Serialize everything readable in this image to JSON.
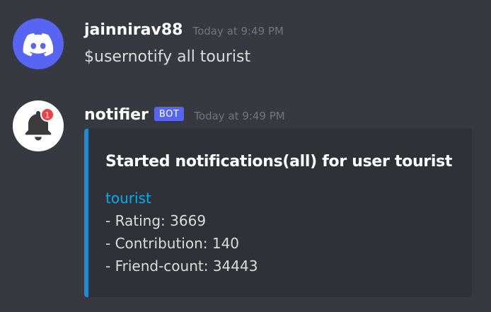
{
  "messages": [
    {
      "author": "jainnirav88",
      "timestamp": "Today at 9:49 PM",
      "avatar_icon": "discord-logo-icon",
      "avatar_color": "#5865f2",
      "content": "$usernotify all tourist"
    },
    {
      "author": "notifier",
      "bot_tag": "BOT",
      "timestamp": "Today at 9:49 PM",
      "avatar_icon": "notification-bell-icon",
      "avatar_badge": "1",
      "embed": {
        "accent_color": "#1f8ad6",
        "title": "Started notifications(all) for user tourist",
        "link_text": "tourist",
        "lines": [
          "- Rating: 3669",
          "- Contribution: 140",
          "- Friend-count: 34443"
        ]
      }
    }
  ],
  "colors": {
    "background": "#36393f",
    "embed_background": "#2f3136",
    "link": "#00aff4",
    "bot_tag": "#5865f2"
  }
}
